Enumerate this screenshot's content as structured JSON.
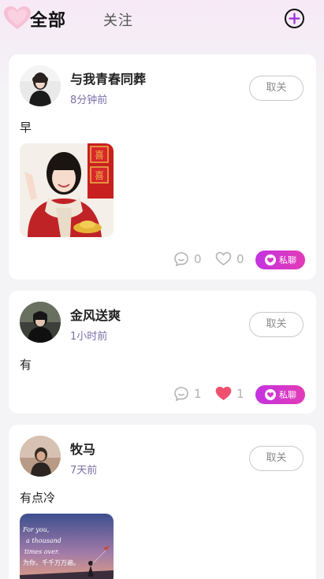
{
  "header": {
    "tab_all": "全部",
    "tab_follow": "关注"
  },
  "posts": [
    {
      "username": "与我青春同葬",
      "time": "8分钟前",
      "unfollow_label": "取关",
      "text": "早",
      "comments": "0",
      "likes": "0",
      "liked": false,
      "chat_label": "私聊",
      "has_image": true
    },
    {
      "username": "金风送爽",
      "time": "1小时前",
      "unfollow_label": "取关",
      "text": "有",
      "comments": "1",
      "likes": "1",
      "liked": true,
      "chat_label": "私聊",
      "has_image": false
    },
    {
      "username": "牧马",
      "time": "7天前",
      "unfollow_label": "取关",
      "text": "有点冷",
      "has_image": true,
      "image_text": {
        "line1": "For you,",
        "line2": "a thousand",
        "line3": "times over.",
        "line4": "为你，千千万万遍。"
      }
    }
  ],
  "colors": {
    "accent_gradient_start": "#c433e0",
    "accent_gradient_end": "#e23bb5",
    "like_active": "#f0506e",
    "timestamp": "#7b6fa8"
  },
  "icons": {
    "add": "plus-circle-icon",
    "comment": "comment-bubble-icon",
    "like": "heart-icon",
    "chat": "chat-heart-icon"
  }
}
